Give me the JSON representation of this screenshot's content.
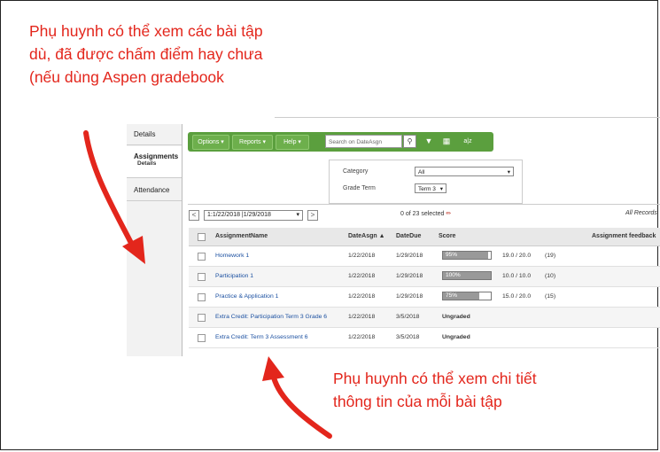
{
  "captions": {
    "top": "Phụ huynh có thể xem các bài tập dù, đã được chấm điểm hay chưa (nếu dùng Aspen gradebook",
    "bottom": "Phụ huynh có thể xem chi tiết thông tin của mỗi bài tập"
  },
  "sidebar": {
    "items": [
      {
        "label": "Details"
      },
      {
        "label": "Assignments",
        "sub": "Details"
      },
      {
        "label": "Attendance"
      }
    ]
  },
  "toolbar": {
    "options": "Options ▾",
    "reports": "Reports ▾",
    "help": "Help ▾",
    "search_placeholder": "Search on DateAsgn",
    "sort_label": "a|z"
  },
  "filters": {
    "category_label": "Category",
    "category_value": "All",
    "term_label": "Grade Term",
    "term_value": "Term 3"
  },
  "navigation": {
    "range": "1:1/22/2018 |1/29/2018",
    "selected": "0 of 23 selected",
    "all_records": "All Records"
  },
  "table": {
    "headers": [
      "AssignmentName",
      "DateAsgn ▲",
      "DateDue",
      "Score",
      "Assignment feedback"
    ],
    "rows": [
      {
        "name": "Homework 1",
        "asgn": "1/22/2018",
        "due": "1/29/2018",
        "pct": "95%",
        "pct_value": 0.95,
        "points": "19.0 / 20.0",
        "count": "(19)"
      },
      {
        "name": "Participation 1",
        "asgn": "1/22/2018",
        "due": "1/29/2018",
        "pct": "100%",
        "pct_value": 1.0,
        "points": "10.0 / 10.0",
        "count": "(10)"
      },
      {
        "name": "Practice & Application 1",
        "asgn": "1/22/2018",
        "due": "1/29/2018",
        "pct": "75%",
        "pct_value": 0.75,
        "points": "15.0 / 20.0",
        "count": "(15)"
      },
      {
        "name": "Extra Credit: Participation Term 3 Grade 6",
        "asgn": "1/22/2018",
        "due": "3/5/2018",
        "ungraded": "Ungraded"
      },
      {
        "name": "Extra Credit: Term 3 Assessment 6",
        "asgn": "1/22/2018",
        "due": "3/5/2018",
        "ungraded": "Ungraded"
      }
    ]
  },
  "colors": {
    "caption": "#e3261c",
    "toolbar": "#5b9f3e",
    "link": "#1a4fa0"
  }
}
